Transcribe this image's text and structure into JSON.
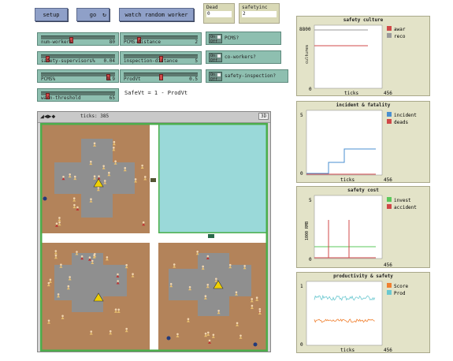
{
  "buttons": {
    "setup": "setup",
    "go": "go",
    "go_icon": "↻",
    "watch": "watch random worker"
  },
  "monitors": [
    {
      "title": "Dead",
      "value": "0"
    },
    {
      "title": "safetyinc",
      "value": "2"
    }
  ],
  "sliders": [
    {
      "label": "num-workers",
      "value": "80",
      "level": 0.4
    },
    {
      "label": "PCMS-distance",
      "value": "2",
      "level": 0.2
    },
    {
      "label": "safety-supervisors%",
      "value": "0.04",
      "level": 0.08
    },
    {
      "label": "inspection-distance",
      "value": "5",
      "level": 0.5
    },
    {
      "label": "PCMS%",
      "value": "0.9",
      "level": 0.9
    },
    {
      "label": "ProdVt",
      "value": "0.5",
      "level": 0.5
    },
    {
      "label": "warn-threshold",
      "value": "65",
      "level": 0.08
    }
  ],
  "switches": [
    {
      "on": "On",
      "off": "Off",
      "label": "PCMS?"
    },
    {
      "on": "On",
      "off": "Off",
      "label": "co-workers?"
    },
    {
      "on": "On",
      "off": "Off",
      "label": "safety-inspection?"
    }
  ],
  "note": "SafeVt = 1 - ProdVt",
  "view": {
    "ticks_label": "ticks: 385",
    "button_3d": "3D",
    "controls": "◢◀▶◆"
  },
  "plots": {
    "safety_culture": {
      "title": "safety culture",
      "ylabel": "cultures",
      "xlabel": "ticks",
      "xmax": "456",
      "ymin": "0",
      "ymax": "8800",
      "legend": [
        {
          "name": "awar",
          "color": "#d04848"
        },
        {
          "name": "reco",
          "color": "#9a9a9a"
        }
      ]
    },
    "incident_fatality": {
      "title": "incident & fatality",
      "xlabel": "ticks",
      "xmax": "456",
      "ymin": "0",
      "ymax": "5",
      "legend": [
        {
          "name": "incident",
          "color": "#4a8fd0"
        },
        {
          "name": "deads",
          "color": "#d04848"
        }
      ]
    },
    "safety_cost": {
      "title": "safety cost",
      "ylabel": "1000 RMB",
      "xlabel": "ticks",
      "xmax": "456",
      "ymin": "0",
      "ymax": "5",
      "legend": [
        {
          "name": "invest",
          "color": "#5bc85b"
        },
        {
          "name": "accident",
          "color": "#d04848"
        }
      ]
    },
    "productivity_safety": {
      "title": "productivity & safety",
      "xlabel": "ticks",
      "xmax": "456",
      "ymin": "0",
      "ymax": "1",
      "legend": [
        {
          "name": "Score",
          "color": "#f08030"
        },
        {
          "name": "Prod",
          "color": "#6ac8d0"
        }
      ]
    }
  }
}
